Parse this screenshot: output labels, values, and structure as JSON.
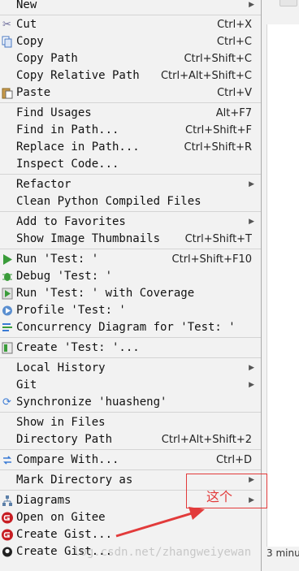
{
  "background": {
    "status_text": "3 minu"
  },
  "menu": {
    "items": [
      {
        "label": "New",
        "shortcut": "",
        "submenu": true,
        "icon": ""
      },
      {
        "label": "Cut",
        "shortcut": "Ctrl+X",
        "submenu": false,
        "icon": "scissors-icon"
      },
      {
        "label": "Copy",
        "shortcut": "Ctrl+C",
        "submenu": false,
        "icon": "copy-icon"
      },
      {
        "label": "Copy Path",
        "shortcut": "Ctrl+Shift+C",
        "submenu": false,
        "icon": ""
      },
      {
        "label": "Copy Relative Path",
        "shortcut": "Ctrl+Alt+Shift+C",
        "submenu": false,
        "icon": ""
      },
      {
        "label": "Paste",
        "shortcut": "Ctrl+V",
        "submenu": false,
        "icon": "paste-icon"
      },
      {
        "label": "Find Usages",
        "shortcut": "Alt+F7",
        "submenu": false,
        "icon": ""
      },
      {
        "label": "Find in Path...",
        "shortcut": "Ctrl+Shift+F",
        "submenu": false,
        "icon": ""
      },
      {
        "label": "Replace in Path...",
        "shortcut": "Ctrl+Shift+R",
        "submenu": false,
        "icon": ""
      },
      {
        "label": "Inspect Code...",
        "shortcut": "",
        "submenu": false,
        "icon": ""
      },
      {
        "label": "Refactor",
        "shortcut": "",
        "submenu": true,
        "icon": ""
      },
      {
        "label": "Clean Python Compiled Files",
        "shortcut": "",
        "submenu": false,
        "icon": ""
      },
      {
        "label": "Add to Favorites",
        "shortcut": "",
        "submenu": true,
        "icon": ""
      },
      {
        "label": "Show Image Thumbnails",
        "shortcut": "Ctrl+Shift+T",
        "submenu": false,
        "icon": ""
      },
      {
        "label": "Run 'Test: '",
        "shortcut": "Ctrl+Shift+F10",
        "submenu": false,
        "icon": "run-icon"
      },
      {
        "label": "Debug 'Test: '",
        "shortcut": "",
        "submenu": false,
        "icon": "debug-icon"
      },
      {
        "label": "Run 'Test: ' with Coverage",
        "shortcut": "",
        "submenu": false,
        "icon": "coverage-icon"
      },
      {
        "label": "Profile 'Test: '",
        "shortcut": "",
        "submenu": false,
        "icon": "profile-icon"
      },
      {
        "label": "Concurrency Diagram for 'Test: '",
        "shortcut": "",
        "submenu": false,
        "icon": "concurrency-icon"
      },
      {
        "label": "Create 'Test: '...",
        "shortcut": "",
        "submenu": false,
        "icon": "python-test-icon"
      },
      {
        "label": "Local History",
        "shortcut": "",
        "submenu": true,
        "icon": ""
      },
      {
        "label": "Git",
        "shortcut": "",
        "submenu": true,
        "icon": ""
      },
      {
        "label": "Synchronize 'huasheng'",
        "shortcut": "",
        "submenu": false,
        "icon": "sync-icon"
      },
      {
        "label": "Show in Files",
        "shortcut": "",
        "submenu": false,
        "icon": ""
      },
      {
        "label": "Directory Path",
        "shortcut": "Ctrl+Alt+Shift+2",
        "submenu": false,
        "icon": ""
      },
      {
        "label": "Compare With...",
        "shortcut": "Ctrl+D",
        "submenu": false,
        "icon": "compare-icon"
      },
      {
        "label": "Mark Directory as",
        "shortcut": "",
        "submenu": true,
        "icon": ""
      },
      {
        "label": "Diagrams",
        "shortcut": "",
        "submenu": true,
        "icon": "diagram-icon"
      },
      {
        "label": "Open on Gitee",
        "shortcut": "",
        "submenu": false,
        "icon": "gitee-icon"
      },
      {
        "label": "Create Gist...",
        "shortcut": "",
        "submenu": false,
        "icon": "gitee-icon"
      },
      {
        "label": "Create Gist...",
        "shortcut": "",
        "submenu": false,
        "icon": "github-icon"
      }
    ]
  },
  "annotation": {
    "text": "这个"
  },
  "watermark": "log.csdn.net/zhangweiyewan",
  "colors": {
    "annotation": "#e23b3b",
    "run_green": "#3a9c3a",
    "gitee_red": "#c71d23",
    "menu_bg": "#f2f2f2"
  }
}
